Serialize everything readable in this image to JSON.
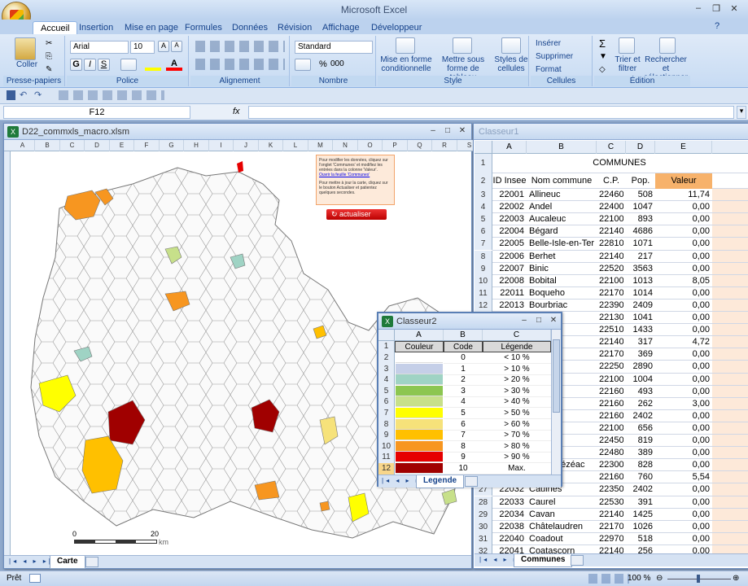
{
  "app": {
    "title": "Microsoft Excel"
  },
  "ribbon": {
    "tabs": [
      "Accueil",
      "Insertion",
      "Mise en page",
      "Formules",
      "Données",
      "Révision",
      "Affichage",
      "Développeur"
    ],
    "clipboard": {
      "paste": "Coller",
      "label": "Presse-papiers"
    },
    "font": {
      "name": "Arial",
      "size": "10",
      "bold": "G",
      "italic": "I",
      "underline": "S",
      "label": "Police"
    },
    "alignment": {
      "label": "Alignement"
    },
    "number": {
      "format": "Standard",
      "percent": "%",
      "thousands": "000",
      "label": "Nombre"
    },
    "style": {
      "cond": "Mise en forme conditionnelle",
      "table": "Mettre sous forme de tableau",
      "cells": "Styles de cellules",
      "label": "Style"
    },
    "cells": {
      "insert": "Insérer",
      "delete": "Supprimer",
      "format": "Format",
      "label": "Cellules"
    },
    "editing": {
      "sum": "Σ",
      "sort": "Trier et filtrer",
      "find": "Rechercher et sélectionner",
      "label": "Édition"
    }
  },
  "formula_bar": {
    "name_box": "F12",
    "fx": "fx",
    "value": ""
  },
  "window_map": {
    "title": "D22_commxls_macro.xlsm",
    "columns": [
      "A",
      "B",
      "C",
      "D",
      "E",
      "F",
      "G",
      "H",
      "I",
      "J",
      "K",
      "L",
      "M",
      "N",
      "O",
      "P",
      "Q",
      "R",
      "S"
    ],
    "note1": "Pour modifier les données, cliquez sur l'onglet 'Communes' et modifiez les entrées dans la colonne 'Valeur'.",
    "note_link": "Ouvrir la feuille 'Communes'",
    "note2": "Pour mettre à jour la carte, cliquez sur le bouton Actualiser et patientez quelques secondes.",
    "refresh_button": "actualiser",
    "scale": {
      "start": "0",
      "end": "20",
      "unit": "km"
    },
    "sheet_tab": "Carte"
  },
  "window_classeur1": {
    "title": "Classeur1",
    "columns": [
      "A",
      "B",
      "C",
      "D",
      "E"
    ],
    "header_row": "COMMUNES",
    "col_labels": [
      "ID Insee",
      "Nom commune",
      "C.P.",
      "Pop.",
      "Valeur"
    ],
    "rows": [
      [
        "3",
        "22001",
        "Allineuc",
        "22460",
        "508",
        "11,74"
      ],
      [
        "4",
        "22002",
        "Andel",
        "22400",
        "1047",
        "0,00"
      ],
      [
        "5",
        "22003",
        "Aucaleuc",
        "22100",
        "893",
        "0,00"
      ],
      [
        "6",
        "22004",
        "Bégard",
        "22140",
        "4686",
        "0,00"
      ],
      [
        "7",
        "22005",
        "Belle-Isle-en-Terre",
        "22810",
        "1071",
        "0,00"
      ],
      [
        "8",
        "22006",
        "Berhet",
        "22140",
        "217",
        "0,00"
      ],
      [
        "9",
        "22007",
        "Binic",
        "22520",
        "3563",
        "0,00"
      ],
      [
        "10",
        "22008",
        "Bobital",
        "22100",
        "1013",
        "8,05"
      ],
      [
        "11",
        "22011",
        "Boqueho",
        "22170",
        "1014",
        "0,00"
      ],
      [
        "12",
        "22013",
        "Bourbriac",
        "22390",
        "2409",
        "0,00"
      ],
      [
        "13",
        "",
        "",
        "22130",
        "1041",
        "0,00"
      ],
      [
        "14",
        "",
        "",
        "22510",
        "1433",
        "0,00"
      ],
      [
        "15",
        "",
        "",
        "22140",
        "317",
        "4,72"
      ],
      [
        "16",
        "",
        "",
        "22170",
        "369",
        "0,00"
      ],
      [
        "17",
        "",
        "",
        "22250",
        "2890",
        "0,00"
      ],
      [
        "18",
        "",
        "",
        "22100",
        "1004",
        "0,00"
      ],
      [
        "19",
        "",
        "stivien",
        "22160",
        "493",
        "0,00"
      ],
      [
        "20",
        "",
        "",
        "22160",
        "262",
        "3,00"
      ],
      [
        "21",
        "",
        "",
        "22160",
        "2402",
        "0,00"
      ],
      [
        "22",
        "",
        "n",
        "22100",
        "656",
        "0,00"
      ],
      [
        "23",
        "",
        "",
        "22450",
        "819",
        "0,00"
      ],
      [
        "24",
        "",
        "",
        "22480",
        "389",
        "0,00"
      ],
      [
        "25",
        "",
        "ec-Lanvézéac",
        "22300",
        "828",
        "0,00"
      ],
      [
        "26",
        "",
        "",
        "22160",
        "760",
        "5,54"
      ],
      [
        "27",
        "22032",
        "Caulnes",
        "22350",
        "2402",
        "0,00"
      ],
      [
        "28",
        "22033",
        "Caurel",
        "22530",
        "391",
        "0,00"
      ],
      [
        "29",
        "22034",
        "Cavan",
        "22140",
        "1425",
        "0,00"
      ],
      [
        "30",
        "22038",
        "Châtelaudren",
        "22170",
        "1026",
        "0,00"
      ],
      [
        "31",
        "22040",
        "Coadout",
        "22970",
        "518",
        "0,00"
      ],
      [
        "32",
        "22041",
        "Coatascorn",
        "22140",
        "256",
        "0,00"
      ]
    ],
    "sheet_tab": "Communes"
  },
  "window_classeur2": {
    "title": "Classeur2",
    "columns": [
      "A",
      "B",
      "C"
    ],
    "headers": [
      "Couleur",
      "Code",
      "Légende"
    ],
    "rows": [
      {
        "row": "2",
        "color": "#ffffff",
        "code": "0",
        "legend": "< 10 %"
      },
      {
        "row": "3",
        "color": "#c5cfe8",
        "code": "1",
        "legend": "> 10 %"
      },
      {
        "row": "4",
        "color": "#9fd3c4",
        "code": "2",
        "legend": "> 20 %"
      },
      {
        "row": "5",
        "color": "#8cc650",
        "code": "3",
        "legend": "> 30 %"
      },
      {
        "row": "6",
        "color": "#c7e08a",
        "code": "4",
        "legend": "> 40 %"
      },
      {
        "row": "7",
        "color": "#ffff00",
        "code": "5",
        "legend": "> 50 %"
      },
      {
        "row": "8",
        "color": "#f6e27a",
        "code": "6",
        "legend": "> 60 %"
      },
      {
        "row": "9",
        "color": "#ffc000",
        "code": "7",
        "legend": "> 70 %"
      },
      {
        "row": "10",
        "color": "#f79620",
        "code": "8",
        "legend": "> 80 %"
      },
      {
        "row": "11",
        "color": "#e60000",
        "code": "9",
        "legend": "> 90 %"
      },
      {
        "row": "12",
        "color": "#a00000",
        "code": "10",
        "legend": "Max."
      }
    ],
    "sheet_tab": "Legende"
  },
  "status": {
    "text": "Prêt",
    "zoom": "100 %"
  }
}
